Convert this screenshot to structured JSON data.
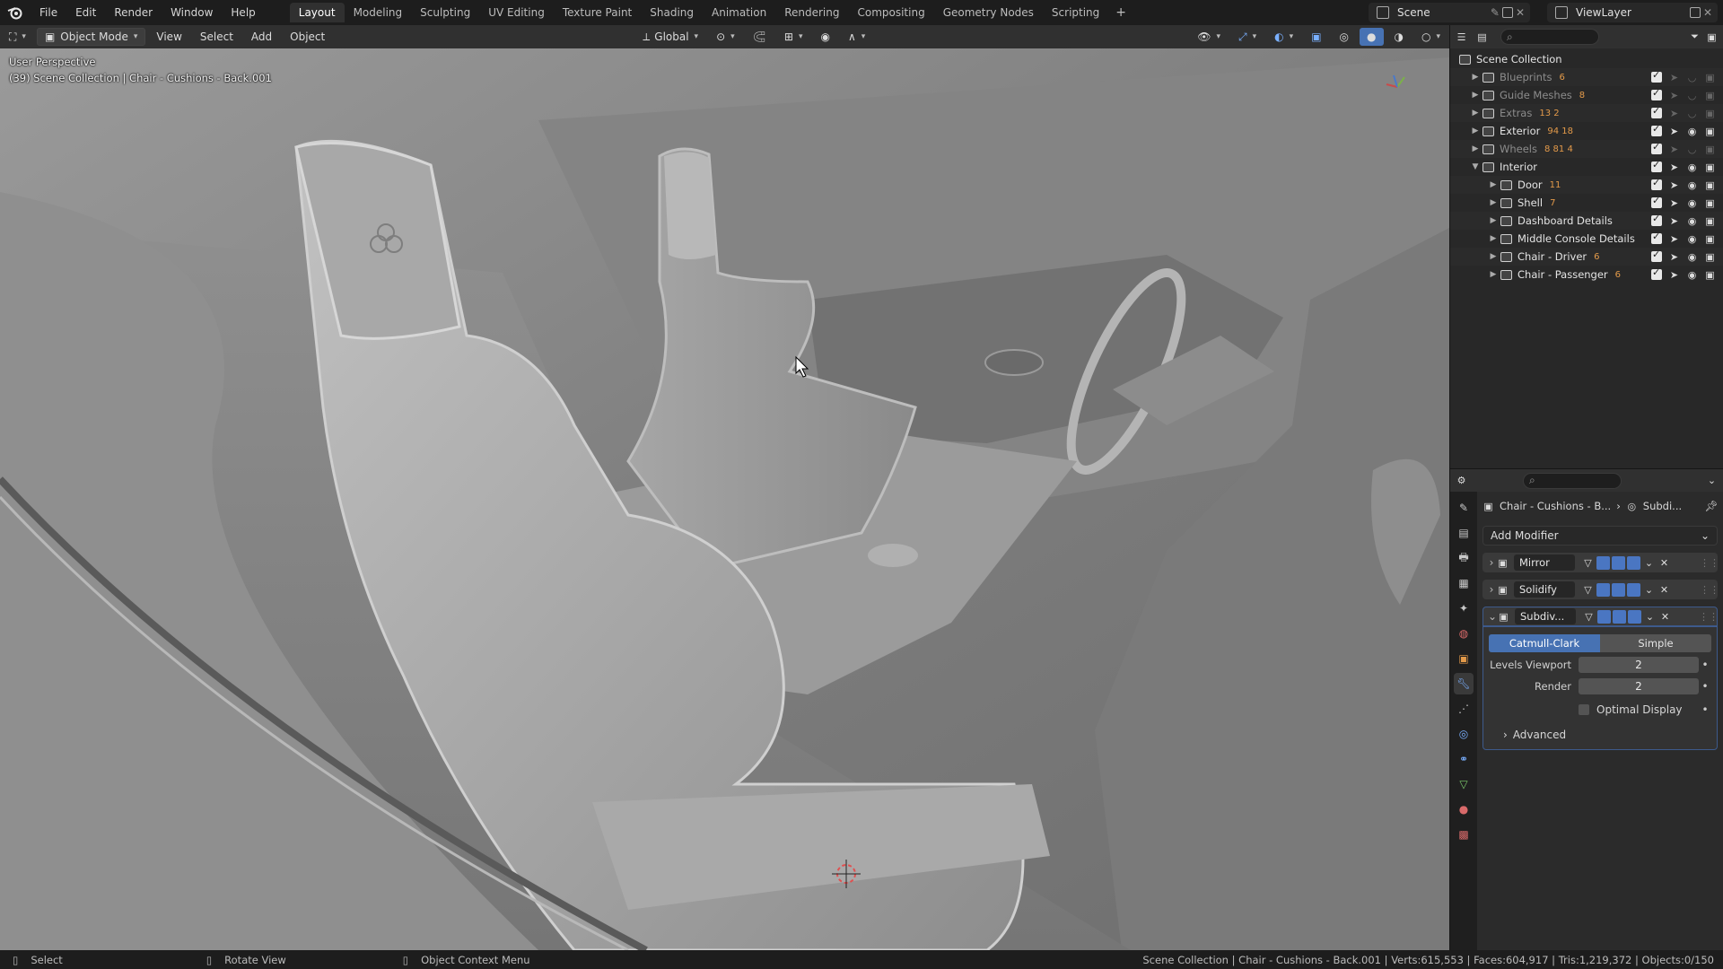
{
  "menus": [
    "File",
    "Edit",
    "Render",
    "Window",
    "Help"
  ],
  "workspaces": [
    {
      "label": "Layout",
      "active": true
    },
    {
      "label": "Modeling"
    },
    {
      "label": "Sculpting"
    },
    {
      "label": "UV Editing"
    },
    {
      "label": "Texture Paint"
    },
    {
      "label": "Shading"
    },
    {
      "label": "Animation"
    },
    {
      "label": "Rendering"
    },
    {
      "label": "Compositing"
    },
    {
      "label": "Geometry Nodes"
    },
    {
      "label": "Scripting"
    }
  ],
  "scene_name": "Scene",
  "view_layer": "ViewLayer",
  "viewport_header": {
    "mode": "Object Mode",
    "menus": [
      "View",
      "Select",
      "Add",
      "Object"
    ],
    "transform_orientation": "Global"
  },
  "viewport": {
    "perspective": "User Perspective",
    "object_info": "(39) Scene Collection | Chair - Cushions - Back.001"
  },
  "outliner": {
    "root": "Scene Collection",
    "items": [
      {
        "name": "Blueprints",
        "badge": "6",
        "dim": true,
        "expanded": false,
        "depth": 1
      },
      {
        "name": "Guide Meshes",
        "badge": "8",
        "dim": true,
        "expanded": false,
        "depth": 1
      },
      {
        "name": "Extras",
        "badge": "13 2",
        "dim": true,
        "expanded": false,
        "depth": 1
      },
      {
        "name": "Exterior",
        "badge": "94 18",
        "dim": false,
        "expanded": false,
        "depth": 1
      },
      {
        "name": "Wheels",
        "badge": "8 81 4",
        "dim": true,
        "expanded": false,
        "depth": 1
      },
      {
        "name": "Interior",
        "badge": "",
        "dim": false,
        "expanded": true,
        "depth": 1
      },
      {
        "name": "Door",
        "badge": "11",
        "dim": false,
        "expanded": false,
        "depth": 2
      },
      {
        "name": "Shell",
        "badge": "7",
        "dim": false,
        "expanded": false,
        "depth": 2
      },
      {
        "name": "Dashboard Details",
        "badge": "",
        "dim": false,
        "expanded": false,
        "depth": 2
      },
      {
        "name": "Middle Console Details",
        "badge": "",
        "dim": false,
        "expanded": false,
        "depth": 2
      },
      {
        "name": "Chair - Driver",
        "badge": "6",
        "dim": false,
        "expanded": false,
        "depth": 2
      },
      {
        "name": "Chair - Passenger",
        "badge": "6",
        "dim": false,
        "expanded": false,
        "depth": 2
      }
    ]
  },
  "properties": {
    "breadcrumb_object": "Chair - Cushions - B...",
    "breadcrumb_modifier": "Subdi...",
    "add_modifier": "Add Modifier",
    "modifiers": [
      {
        "name": "Mirror",
        "expanded": false
      },
      {
        "name": "Solidify",
        "expanded": false
      },
      {
        "name": "Subdiv...",
        "expanded": true
      }
    ],
    "subdiv": {
      "mode_a": "Catmull-Clark",
      "mode_b": "Simple",
      "levels_viewport_label": "Levels Viewport",
      "levels_viewport": "2",
      "render_label": "Render",
      "render": "2",
      "optimal_display": "Optimal Display",
      "advanced": "Advanced"
    }
  },
  "statusbar": {
    "select": "Select",
    "rotate": "Rotate View",
    "context": "Object Context Menu",
    "stats": "Scene Collection | Chair - Cushions - Back.001 | Verts:615,553 | Faces:604,917 | Tris:1,219,372 | Objects:0/150"
  }
}
